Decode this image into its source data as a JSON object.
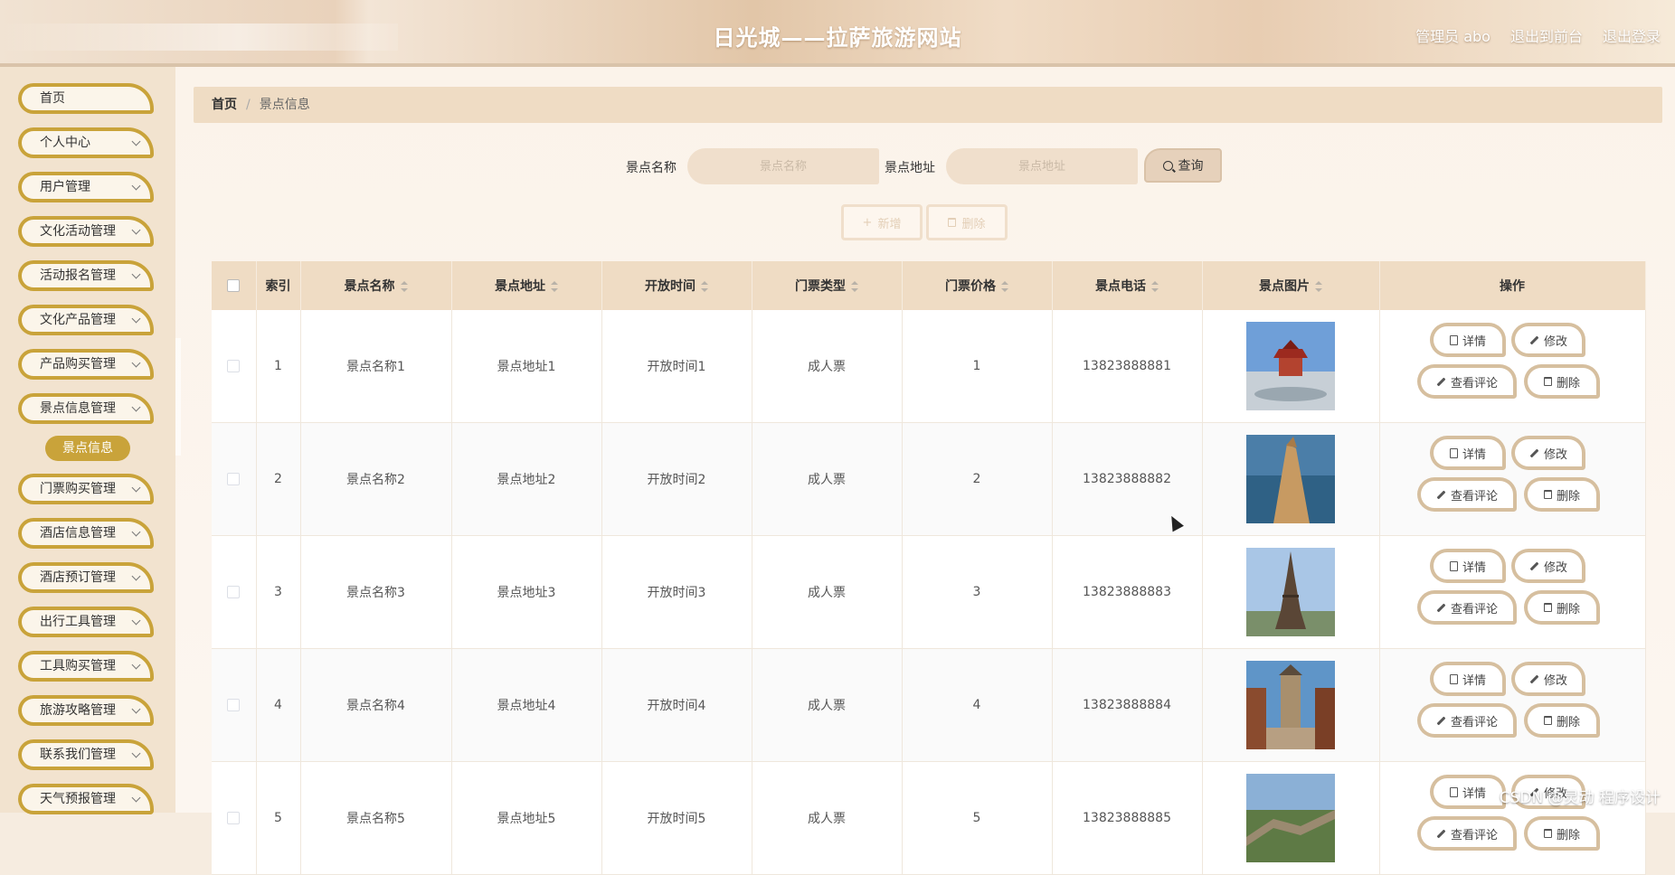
{
  "header": {
    "title": "日光城——拉萨旅游网站",
    "user_label": "管理员 abo",
    "back_front": "退出到前台",
    "logout": "退出登录"
  },
  "sidebar": {
    "items": [
      {
        "label": "首页",
        "expandable": false
      },
      {
        "label": "个人中心",
        "expandable": true
      },
      {
        "label": "用户管理",
        "expandable": true
      },
      {
        "label": "文化活动管理",
        "expandable": true
      },
      {
        "label": "活动报名管理",
        "expandable": true
      },
      {
        "label": "文化产品管理",
        "expandable": true
      },
      {
        "label": "产品购买管理",
        "expandable": true
      },
      {
        "label": "景点信息管理",
        "expandable": true
      },
      {
        "label": "门票购买管理",
        "expandable": true
      },
      {
        "label": "酒店信息管理",
        "expandable": true
      },
      {
        "label": "酒店预订管理",
        "expandable": true
      },
      {
        "label": "出行工具管理",
        "expandable": true
      },
      {
        "label": "工具购买管理",
        "expandable": true
      },
      {
        "label": "旅游攻略管理",
        "expandable": true
      },
      {
        "label": "联系我们管理",
        "expandable": true
      },
      {
        "label": "天气预报管理",
        "expandable": true
      }
    ],
    "active_sub": "景点信息"
  },
  "breadcrumb": {
    "home": "首页",
    "current": "景点信息"
  },
  "search": {
    "name_label": "景点名称",
    "name_placeholder": "景点名称",
    "addr_label": "景点地址",
    "addr_placeholder": "景点地址",
    "query_button": "查询"
  },
  "actions": {
    "add": "新增",
    "delete": "删除"
  },
  "table": {
    "columns": [
      "索引",
      "景点名称",
      "景点地址",
      "开放时间",
      "门票类型",
      "门票价格",
      "景点电话",
      "景点图片",
      "操作"
    ],
    "rows": [
      {
        "index": "1",
        "name": "景点名称1",
        "address": "景点地址1",
        "open_time": "开放时间1",
        "ticket_type": "成人票",
        "price": "1",
        "phone": "13823888881",
        "image": "temple-photo"
      },
      {
        "index": "2",
        "name": "景点名称2",
        "address": "景点地址2",
        "open_time": "开放时间2",
        "ticket_type": "成人票",
        "price": "2",
        "phone": "13823888882",
        "image": "sea-cliff-photo"
      },
      {
        "index": "3",
        "name": "景点名称3",
        "address": "景点地址3",
        "open_time": "开放时间3",
        "ticket_type": "成人票",
        "price": "3",
        "phone": "13823888883",
        "image": "eiffel-tower-photo"
      },
      {
        "index": "4",
        "name": "景点名称4",
        "address": "景点地址4",
        "open_time": "开放时间4",
        "ticket_type": "成人票",
        "price": "4",
        "phone": "13823888884",
        "image": "old-town-tower-photo"
      },
      {
        "index": "5",
        "name": "景点名称5",
        "address": "景点地址5",
        "open_time": "开放时间5",
        "ticket_type": "成人票",
        "price": "5",
        "phone": "13823888885",
        "image": "great-wall-photo"
      }
    ],
    "ops": {
      "detail": "详情",
      "edit": "修改",
      "review": "查看评论",
      "delete": "删除"
    }
  },
  "watermark": "CSDN @灵动 程序设计",
  "colors": {
    "accent_gold": "#c9a33a",
    "header_beige": "#efdcc4",
    "border_tan": "#d6bf9f"
  }
}
